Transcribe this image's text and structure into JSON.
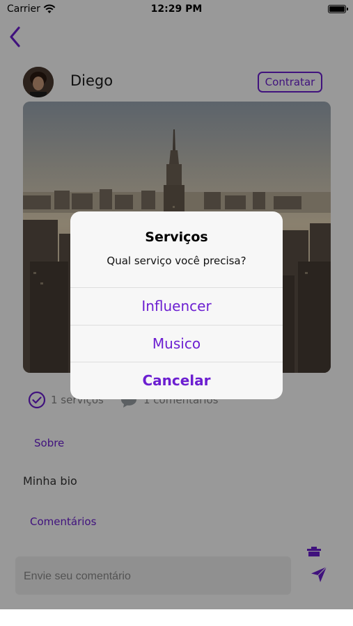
{
  "status_bar": {
    "carrier": "Carrier",
    "time": "12:29 PM"
  },
  "profile": {
    "name": "Diego",
    "hire_button": "Contratar"
  },
  "stats": {
    "services": "1 serviços",
    "comments": "1 comentários"
  },
  "sections": {
    "about_title": "Sobre",
    "bio": "Minha bio",
    "comments_title": "Comentários"
  },
  "comment_input": {
    "placeholder": "Envie seu comentário"
  },
  "dialog": {
    "title": "Serviços",
    "message": "Qual serviço você precisa?",
    "options": [
      "Influencer",
      "Musico"
    ],
    "cancel": "Cancelar"
  },
  "colors": {
    "accent": "#6c1fd1",
    "overlay": "#00000066"
  }
}
